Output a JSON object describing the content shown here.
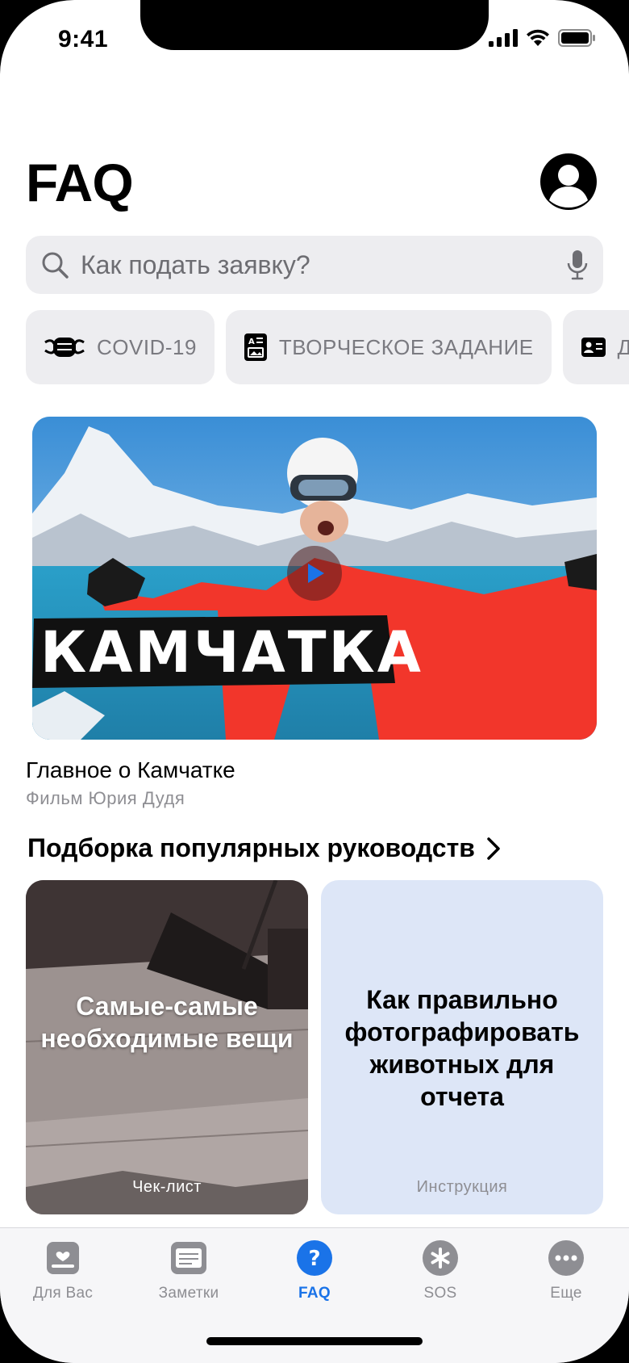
{
  "status": {
    "time": "9:41"
  },
  "header": {
    "title": "FAQ"
  },
  "search": {
    "placeholder": "Как подать заявку?"
  },
  "chips": [
    {
      "label": "COVID-19",
      "icon": "mask-icon"
    },
    {
      "label": "ТВОРЧЕСКОЕ ЗАДАНИЕ",
      "icon": "creative-task-icon"
    },
    {
      "label": "ДО",
      "icon": "id-card-icon"
    }
  ],
  "video": {
    "overlay_text": "КАМЧАТКА",
    "title": "Главное о Камчатке",
    "subtitle": "Фильм Юрия Дудя"
  },
  "section": {
    "title": "Подборка популярных руководств"
  },
  "cards": [
    {
      "title": "Самые-самые необходимые вещи",
      "tag": "Чек-лист"
    },
    {
      "title": "Как правильно фотографировать животных для отчета",
      "tag": "Инструкция"
    }
  ],
  "tabs": [
    {
      "label": "Для Вас",
      "icon": "for-you-icon"
    },
    {
      "label": "Заметки",
      "icon": "notes-icon"
    },
    {
      "label": "FAQ",
      "icon": "faq-icon",
      "active": true
    },
    {
      "label": "SOS",
      "icon": "sos-icon"
    },
    {
      "label": "Еще",
      "icon": "more-icon"
    }
  ],
  "colors": {
    "accent": "#1a73e8",
    "chip_bg": "#ededf0",
    "card_blue": "#dde6f7"
  }
}
